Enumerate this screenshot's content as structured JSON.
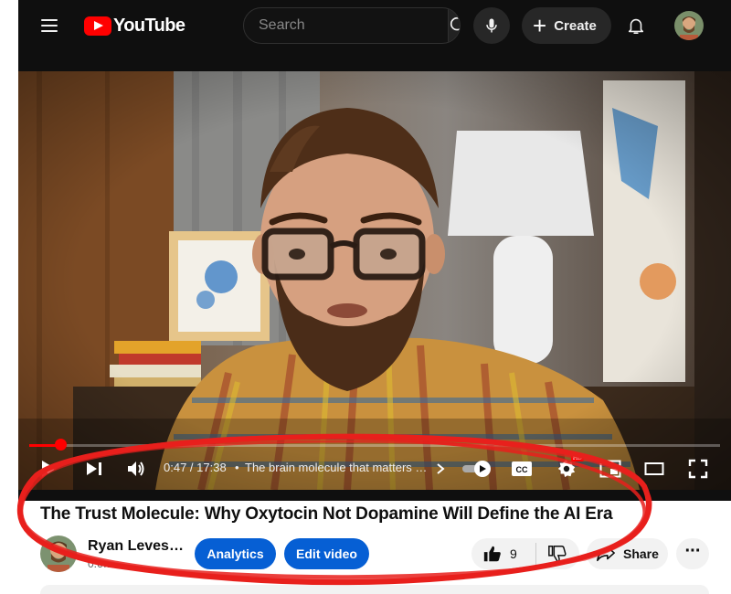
{
  "brand": {
    "logo_text": "YouTube"
  },
  "search": {
    "placeholder": "Search"
  },
  "header": {
    "create_label": "Create"
  },
  "player": {
    "current_time": "0:47",
    "duration": "17:38",
    "time_display": "0:47 / 17:38",
    "chapter_title": "The brain molecule that matters …",
    "progress_fraction": 0.045,
    "quality_badge": "HD"
  },
  "video": {
    "title": "The Trust Molecule: Why Oxytocin Not Dopamine Will Define the AI Era",
    "channel_name": "Ryan Leves…",
    "channel_subs": "0.6…"
  },
  "actions": {
    "analytics_label": "Analytics",
    "edit_video_label": "Edit video",
    "like_count": "9",
    "share_label": "Share"
  },
  "colors": {
    "brand_red": "#ff0000",
    "accent_blue": "#065fd4",
    "annotation_red": "#e8201c",
    "dark_bg": "#0f0f0f"
  },
  "icons": [
    "menu-icon",
    "youtube-logo-icon",
    "search-icon",
    "mic-icon",
    "plus-icon",
    "bell-icon",
    "play-icon",
    "next-icon",
    "volume-icon",
    "chevron-right-icon",
    "autoplay-toggle-icon",
    "captions-icon",
    "settings-icon",
    "miniplayer-icon",
    "theater-icon",
    "fullscreen-icon",
    "thumbs-up-icon",
    "share-icon",
    "more-icon"
  ]
}
